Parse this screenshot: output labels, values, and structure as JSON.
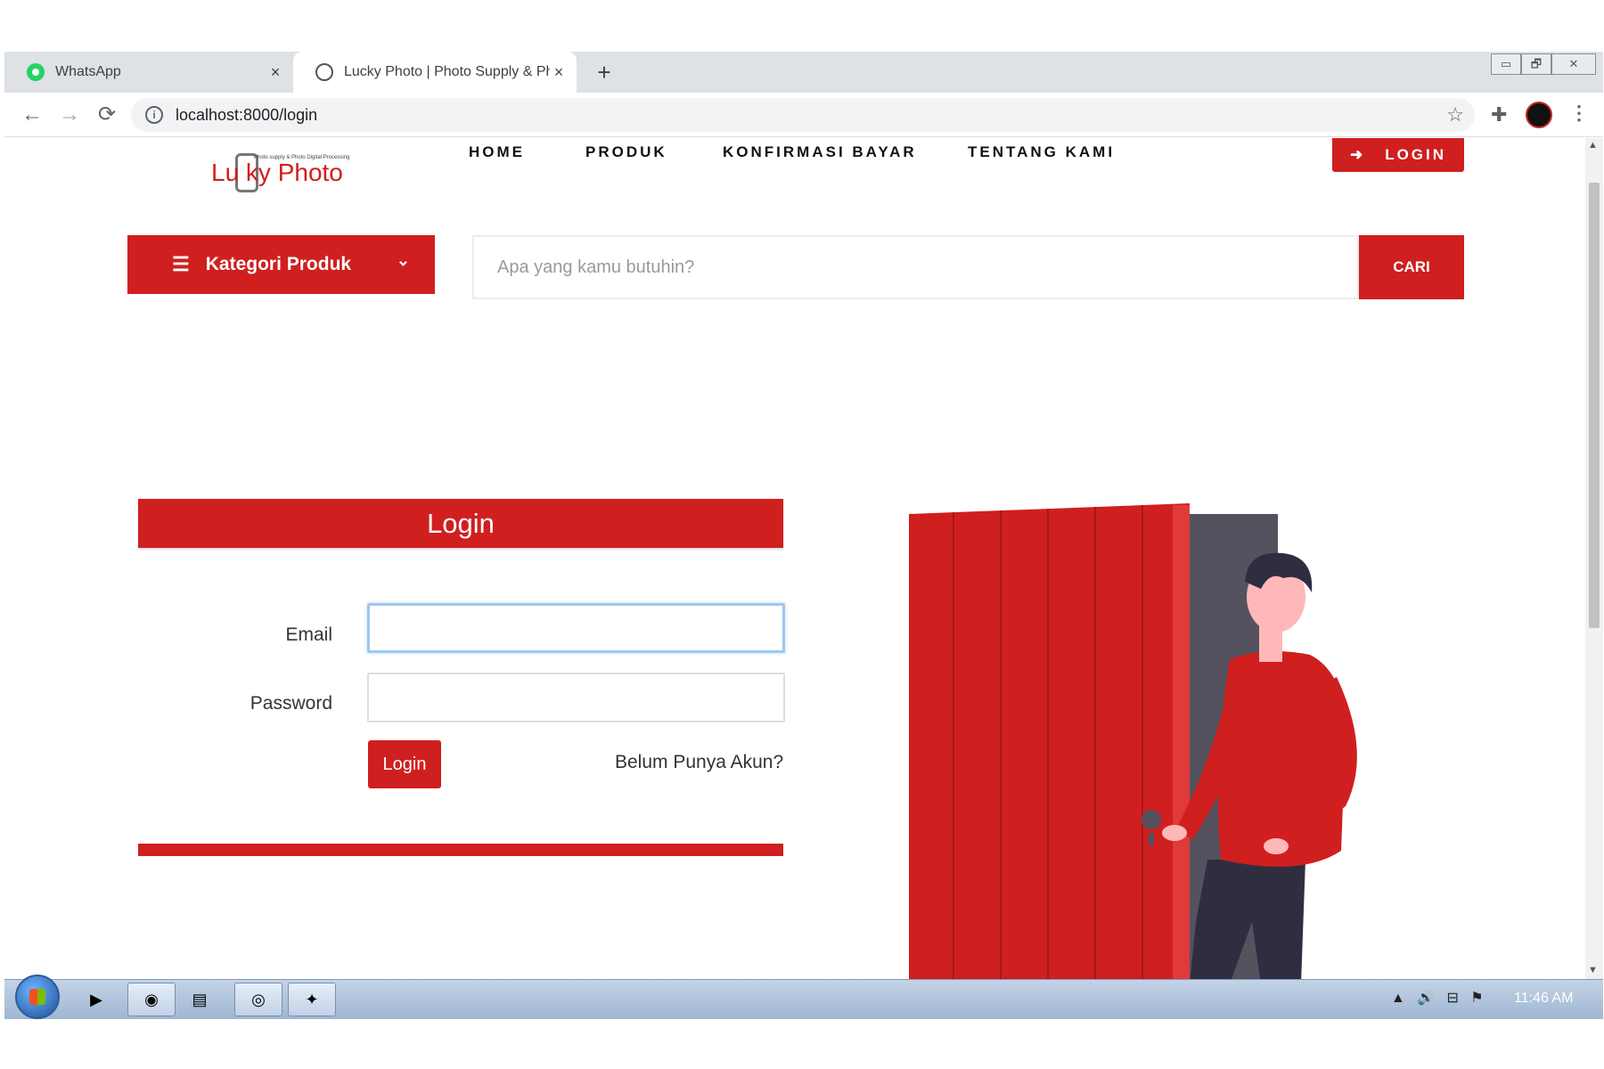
{
  "browser": {
    "tabs": [
      {
        "title": "WhatsApp",
        "icon": "whatsapp-icon"
      },
      {
        "title": "Lucky Photo | Photo Supply & Ph",
        "icon": "lucky-photo-icon"
      }
    ],
    "new_tab": "+",
    "tab_close": "×",
    "url": "localhost:8000/login",
    "window_controls": {
      "minimize": "▭",
      "restore": "🗗",
      "close": "✕"
    }
  },
  "site": {
    "logo_text": "Lu  ky Photo",
    "logo_tagline": "Photo supply & Photo Digital Processing",
    "brand_color": "#d01f1f",
    "nav": [
      {
        "label": "HOME"
      },
      {
        "label": "PRODUK"
      },
      {
        "label": "KONFIRMASI BAYAR"
      },
      {
        "label": "TENTANG KAMI"
      }
    ],
    "login_button": "LOGIN",
    "category_button": "Kategori Produk",
    "search": {
      "placeholder": "Apa yang kamu butuhin?",
      "button": "CARI"
    }
  },
  "login_form": {
    "title": "Login",
    "email_label": "Email",
    "email_value": "",
    "password_label": "Password",
    "password_value": "",
    "submit": "Login",
    "register_link": "Belum Punya Akun?"
  },
  "taskbar": {
    "clock": "11:46 AM",
    "tray_icons": [
      "▲",
      "🔊",
      "⊟",
      "⚑"
    ]
  }
}
